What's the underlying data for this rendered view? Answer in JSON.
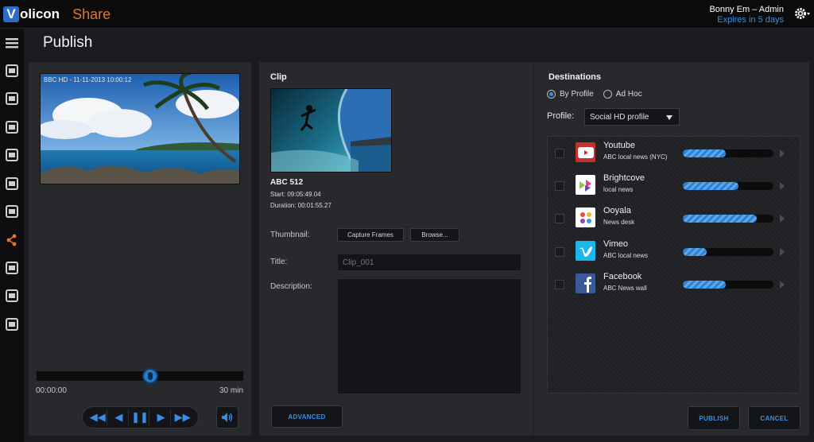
{
  "app": {
    "logo_v": "V",
    "logo_text": "olicon",
    "product": "Share"
  },
  "user": {
    "name": "Bonny Em – Admin",
    "expires": "Expires in 5 days"
  },
  "page": {
    "title": "Publish"
  },
  "sidebar": {
    "items": [
      "menu-icon",
      "film-icon",
      "search-icon",
      "bookmark-icon",
      "export-icon",
      "grid-icon",
      "play-doc-icon",
      "share-icon",
      "clock-icon",
      "transfer-icon",
      "list-icon"
    ],
    "active_index": 7
  },
  "player": {
    "overlay": "BBC HD -  11-11-2013   10:00:12",
    "time_start": "00:00:00",
    "time_end": "30 min",
    "position": 0.55
  },
  "clip": {
    "heading": "Clip",
    "name": "ABC 512",
    "start": "Start: 09:05:49.04",
    "duration": "Duration: 00:01:55.27",
    "thumbnail_label": "Thumbnail:",
    "capture_button": "Capture Frames",
    "browse_button": "Browse...",
    "title_label": "Title:",
    "title_placeholder": "Clip_001",
    "description_label": "Description:",
    "advanced_button": "ADVANCED"
  },
  "destinations": {
    "heading": "Destinations",
    "mode_by_profile": "By Profile",
    "mode_ad_hoc": "Ad Hoc",
    "selected_mode": "By Profile",
    "profile_label": "Profile:",
    "profile_value": "Social HD profile",
    "items": [
      {
        "name": "Youtube",
        "sub": "ABC local news (NYC)",
        "icon": "youtube-icon",
        "color": "#c4302b",
        "progress": 0.47
      },
      {
        "name": "Brightcove",
        "sub": "local news",
        "icon": "brightcove-icon",
        "color": "#ffffff",
        "progress": 0.61
      },
      {
        "name": "Ooyala",
        "sub": "News desk",
        "icon": "ooyala-icon",
        "color": "#ffffff",
        "progress": 0.82
      },
      {
        "name": "Vimeo",
        "sub": "ABC local news",
        "icon": "vimeo-icon",
        "color": "#1ab7ea",
        "progress": 0.26
      },
      {
        "name": "Facebook",
        "sub": "ABC News wall",
        "icon": "facebook-icon",
        "color": "#3b5998",
        "progress": 0.47
      }
    ]
  },
  "actions": {
    "publish": "PUBLISH",
    "cancel": "CANCEL"
  },
  "colors": {
    "accent": "#3a8ee6",
    "brand_orange": "#e0762b",
    "panel": "#28292d"
  }
}
